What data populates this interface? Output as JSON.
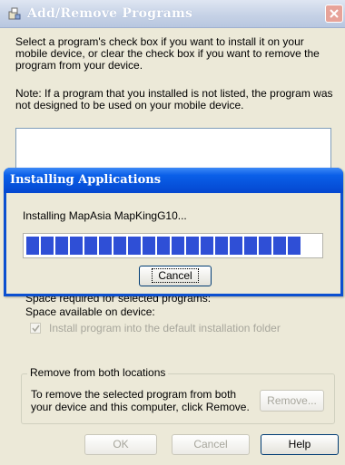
{
  "window": {
    "title": "Add/Remove Programs",
    "description": "Select a program's check box if you want to install it on your mobile device, or clear the check box if you want to remove the program from your device.",
    "note": "Note:  If a program that you installed is not listed, the program was not designed to be used on your mobile device.",
    "space_required_label": "Space required for selected programs:",
    "space_available_label": "Space available on device:",
    "install_default_folder_label": "Install program into the default installation folder",
    "install_default_folder_checked": true,
    "remove_group_title": "Remove from both locations",
    "remove_group_text": "To remove the selected program from both your device and this computer, click Remove.",
    "remove_button": "Remove...",
    "ok_button": "OK",
    "cancel_button": "Cancel",
    "help_button": "Help"
  },
  "progress_dialog": {
    "title": "Installing Applications",
    "message": "Installing MapAsia MapKingG10...",
    "progress_segments_filled": 19,
    "cancel_button": "Cancel"
  },
  "colors": {
    "window_bg": "#ECE9D8",
    "dialog_title_blue": "#0447d0",
    "progress_blue": "#2f4fd6"
  }
}
